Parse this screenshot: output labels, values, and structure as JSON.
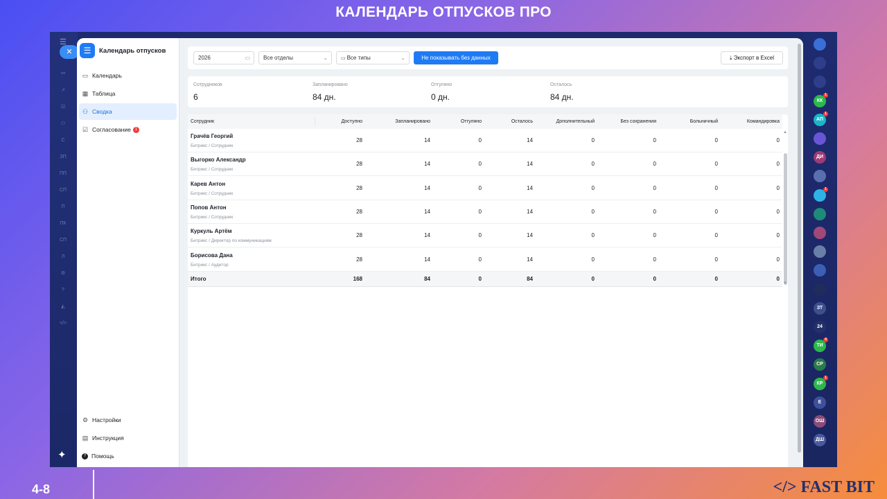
{
  "slide": {
    "title": "КАЛЕНДАРЬ ОТПУСКОВ ПРО",
    "number": "4-8",
    "brand": "</> FAST BIT"
  },
  "sidebar": {
    "title": "Календарь отпусков",
    "items": [
      {
        "label": "Календарь",
        "icon": "calendar-icon",
        "glyph": "▭"
      },
      {
        "label": "Таблица",
        "icon": "table-icon",
        "glyph": "▦"
      },
      {
        "label": "Сводка",
        "icon": "people-icon",
        "glyph": "⚇",
        "active": true
      },
      {
        "label": "Согласование",
        "icon": "check-square-icon",
        "glyph": "☑",
        "badge": "1"
      }
    ],
    "bottom": [
      {
        "label": "Настройки",
        "icon": "gear-icon",
        "glyph": "⚙"
      },
      {
        "label": "Инструкция",
        "icon": "book-icon",
        "glyph": "▤"
      },
      {
        "label": "Помощь",
        "icon": "help-icon",
        "glyph": "?"
      }
    ]
  },
  "toolbar": {
    "year": "2026",
    "department": "Все отделы",
    "type": "Все типы",
    "hide_empty_label": "Не показывать без данных",
    "export_label": "Экспорт в Excel"
  },
  "stats": [
    {
      "label": "Сотрудников",
      "value": "6"
    },
    {
      "label": "Запланировано",
      "value": "84 дн."
    },
    {
      "label": "Отгуляно",
      "value": "0 дн."
    },
    {
      "label": "Осталось",
      "value": "84 дн."
    }
  ],
  "table": {
    "columns": [
      "Сотрудник",
      "Доступно",
      "Запланировано",
      "Отгуляно",
      "Осталось",
      "Дополнительный",
      "Без сохранения",
      "Больничный",
      "Командировка"
    ],
    "rows": [
      {
        "name": "Грачёв Георгий",
        "role": "Битрикс / Сотрудник",
        "values": [
          "28",
          "14",
          "0",
          "14",
          "0",
          "0",
          "0",
          "0"
        ]
      },
      {
        "name": "Выгорко Александр",
        "role": "Битрикс / Сотрудник",
        "values": [
          "28",
          "14",
          "0",
          "14",
          "0",
          "0",
          "0",
          "0"
        ]
      },
      {
        "name": "Карев Антон",
        "role": "Битрикс / Сотрудник",
        "values": [
          "28",
          "14",
          "0",
          "14",
          "0",
          "0",
          "0",
          "0"
        ]
      },
      {
        "name": "Попов Антон",
        "role": "Битрикс / Сотрудник",
        "values": [
          "28",
          "14",
          "0",
          "14",
          "0",
          "0",
          "0",
          "0"
        ]
      },
      {
        "name": "Куркуль Артём",
        "role": "Битрикс / Директор по коммуникациям",
        "values": [
          "28",
          "14",
          "0",
          "14",
          "0",
          "0",
          "0",
          "0"
        ]
      },
      {
        "name": "Борисова Дана",
        "role": "Битрикс / Аудитор",
        "values": [
          "28",
          "14",
          "0",
          "14",
          "0",
          "0",
          "0",
          "0"
        ]
      }
    ],
    "total": {
      "name": "Итого",
      "values": [
        "168",
        "84",
        "0",
        "84",
        "0",
        "0",
        "0",
        "0"
      ]
    }
  },
  "right_panel": [
    {
      "initials": "",
      "color": "#3a6fd8",
      "badge": ""
    },
    {
      "initials": "",
      "color": "#2f3e8a",
      "badge": ""
    },
    {
      "initials": "",
      "color": "#2f3e8a",
      "badge": ""
    },
    {
      "initials": "КК",
      "color": "#2db84d",
      "badge": "1"
    },
    {
      "initials": "АП",
      "color": "#19b6c9",
      "badge": "1"
    },
    {
      "initials": "",
      "color": "#6a55d6",
      "badge": ""
    },
    {
      "initials": "ДИ",
      "color": "#9b3c76",
      "badge": ""
    },
    {
      "initials": "",
      "color": "#5a6fb0",
      "badge": ""
    },
    {
      "initials": "",
      "color": "#2fb3e6",
      "badge": "1"
    },
    {
      "initials": "",
      "color": "#1f8a7a",
      "badge": ""
    },
    {
      "initials": "",
      "color": "#a0487a",
      "badge": ""
    },
    {
      "initials": "",
      "color": "#6a7fa8",
      "badge": ""
    },
    {
      "initials": "",
      "color": "#3c5fb5",
      "badge": ""
    },
    {
      "initials": "",
      "color": "#202c5c",
      "badge": ""
    },
    {
      "initials": "ЗТ",
      "color": "#3e4f8c",
      "badge": ""
    },
    {
      "initials": "24",
      "color": "#24306a",
      "badge": ""
    },
    {
      "initials": "ТИ",
      "color": "#2db84d",
      "badge": "4"
    },
    {
      "initials": "СР",
      "color": "#2a7a4a",
      "badge": ""
    },
    {
      "initials": "КР",
      "color": "#2db84d",
      "badge": "1"
    },
    {
      "initials": "Е",
      "color": "#3e4f9c",
      "badge": ""
    },
    {
      "initials": "ОШ",
      "color": "#8a4c7a",
      "badge": ""
    },
    {
      "initials": "ДШ",
      "color": "#4a5a9c",
      "badge": ""
    }
  ]
}
